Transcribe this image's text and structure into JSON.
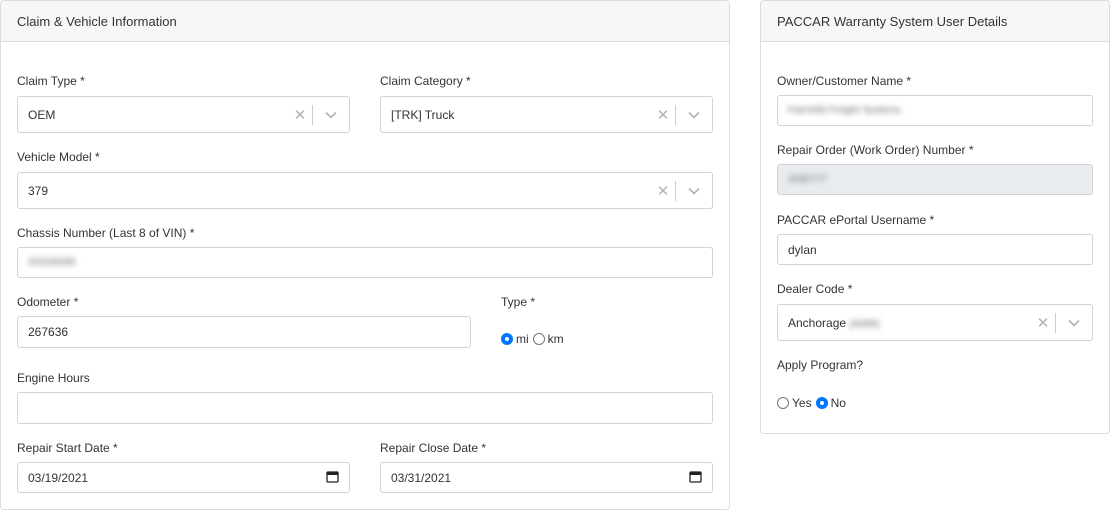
{
  "claim_card": {
    "title": "Claim & Vehicle Information",
    "claim_type": {
      "label": "Claim Type *",
      "value": "OEM"
    },
    "claim_category": {
      "label": "Claim Category *",
      "value": "[TRK] Truck"
    },
    "vehicle_model": {
      "label": "Vehicle Model *",
      "value": "379"
    },
    "chassis": {
      "label": "Chassis Number (Last 8 of VIN) *",
      "value": "XD536699"
    },
    "odometer": {
      "label": "Odometer *",
      "value": "267636"
    },
    "type": {
      "label": "Type *",
      "options": [
        "mi",
        "km"
      ],
      "selected": "mi"
    },
    "engine_hours": {
      "label": "Engine Hours",
      "value": ""
    },
    "repair_start": {
      "label": "Repair Start Date *",
      "value": "03/19/2021"
    },
    "repair_close": {
      "label": "Repair Close Date *",
      "value": "03/31/2021"
    }
  },
  "user_card": {
    "title": "PACCAR Warranty System User Details",
    "owner": {
      "label": "Owner/Customer Name *",
      "value": "Fairchild Freight Systems"
    },
    "repair_order": {
      "label": "Repair Order (Work Order) Number *",
      "value": "3182777"
    },
    "username": {
      "label": "PACCAR ePortal Username *",
      "value": "dylan"
    },
    "dealer_code": {
      "label": "Dealer Code *",
      "value_prefix": "Anchorage",
      "value_suffix": "(A999)"
    },
    "apply_program": {
      "label": "Apply Program?",
      "options": [
        "Yes",
        "No"
      ],
      "selected": "No"
    }
  },
  "icons": {
    "clear": "close-icon",
    "dropdown": "chevron-down-icon",
    "calendar": "calendar-icon"
  },
  "colors": {
    "accent": "#0075ff",
    "header_bg": "#f7f7f7",
    "disabled_bg": "#e9ecef"
  }
}
